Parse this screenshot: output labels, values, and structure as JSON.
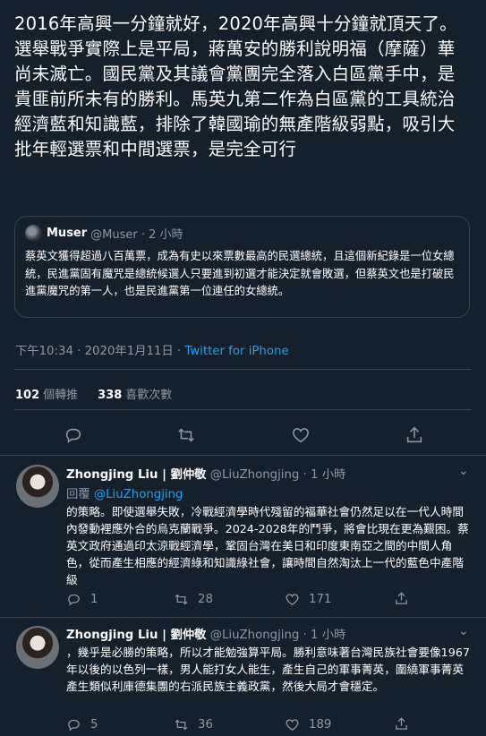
{
  "tweet": {
    "text": "2016年高興一分鐘就好，2020年高興十分鐘就頂天了。選舉戰爭實際上是平局，蔣萬安的勝利說明福（摩薩）華尚未滅亡。國民黨及其議會黨團完全落入白區黨手中，是貴匪前所未有的勝利。馬英九第二作為白區黨的工具統治經濟藍和知識藍，排除了韓國瑜的無產階級弱點，吸引大批年輕選票和中間選票，是完全可行",
    "timestamp": "下午10:34 · 2020年1月11日 · ",
    "source": "Twitter for iPhone",
    "retweets_count": "102",
    "retweets_label": "個轉推",
    "likes_count": "338",
    "likes_label": "喜歡次數"
  },
  "quoted": {
    "name": "Muser",
    "meta": "@Muser · 2 小時",
    "text": "蔡英文獲得超過八百萬票，成為有史以來票數最高的民選總統，且這個新紀錄是一位女總統，民進黨固有魔咒是總統候選人只要進到初選才能決定就會敗選，但蔡英文也是打破民進黨魔咒的第一人，也是民進黨第一位連任的女總統。"
  },
  "replies": [
    {
      "name": "Zhongjing Liu | 劉仲敬",
      "meta": "@LiuZhongjing · 1 小時",
      "reply_prefix": "回覆 ",
      "reply_to": "@LiuZhongjing",
      "text": "的策略。即使選舉失敗，冷戰經濟學時代殘留的福華社會仍然足以在一代人時間內發動裡應外合的烏克蘭戰爭。2024-2028年的鬥爭，將會比現在更為艱困。蔡英文政府通過印太涼戰經濟學，鞏固台灣在美日和印度東南亞之間的中間人角色，從而產生相應的經濟綠和知識綠社會，讓時間自然淘汰上一代的藍色中產階級",
      "replies_count": "1",
      "retweets_count": "28",
      "likes_count": "171"
    },
    {
      "name": "Zhongjing Liu | 劉仲敬",
      "meta": "@LiuZhongjing · 1 小時",
      "text": "，幾乎是必勝的策略，所以才能勉強算平局。勝利意味著台灣民族社會要像1967年以後的以色列一樣，男人能打女人能生，產生自己的軍事菁英，圍繞軍事菁英產生類似利庫德集團的右派民族主義政黨，然後大局才會穩定。",
      "replies_count": "5",
      "retweets_count": "36",
      "likes_count": "189"
    }
  ]
}
